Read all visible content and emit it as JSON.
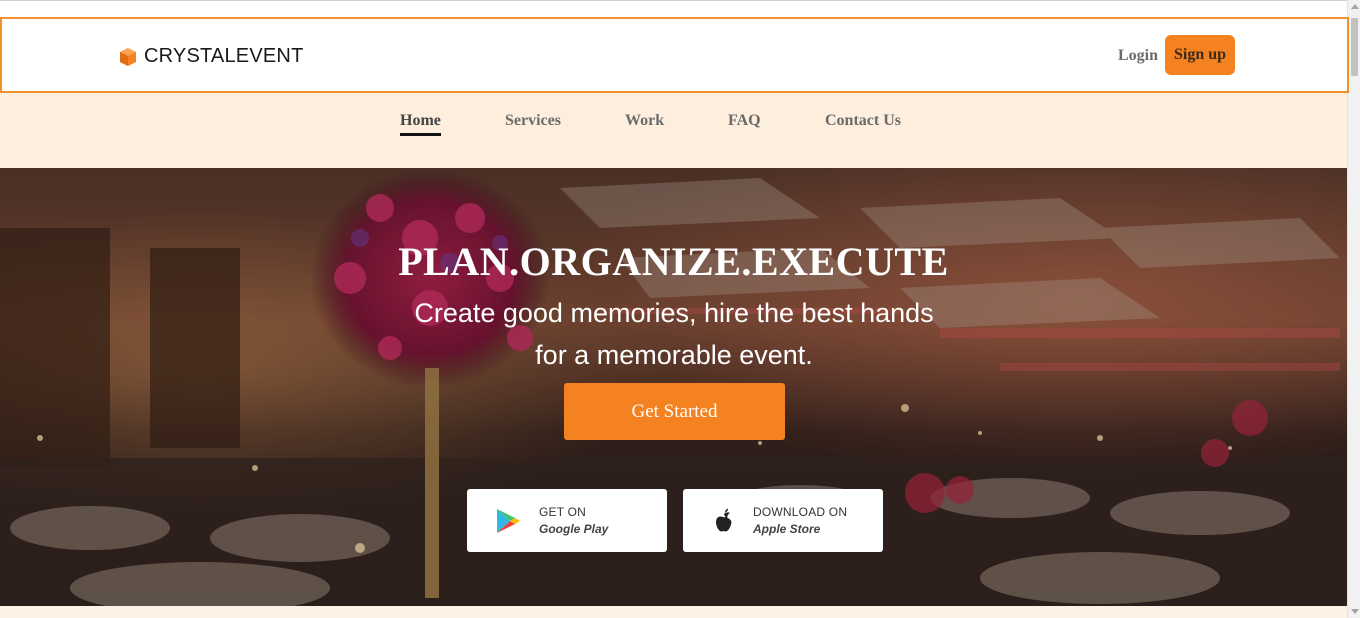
{
  "brand": {
    "name": "CRYSTALEVENT",
    "icon": "cube-icon",
    "icon_color": "#f58220"
  },
  "header": {
    "login_label": "Login",
    "signup_label": "Sign up"
  },
  "nav": {
    "items": [
      {
        "label": "Home",
        "active": true
      },
      {
        "label": "Services",
        "active": false
      },
      {
        "label": "Work",
        "active": false
      },
      {
        "label": "FAQ",
        "active": false
      },
      {
        "label": "Contact Us",
        "active": false
      }
    ]
  },
  "hero": {
    "title": "PLAN.ORGANIZE.EXECUTE",
    "subtitle_line1": "Create good memories, hire the best hands",
    "subtitle_line2": "for a memorable event.",
    "cta_label": "Get Started",
    "background": "banquet-hall-photo"
  },
  "stores": [
    {
      "line1": "GET ON",
      "line2": "Google Play",
      "icon": "google-play-icon"
    },
    {
      "line1": "DOWNLOAD ON",
      "line2": "Apple Store",
      "icon": "apple-icon"
    }
  ],
  "colors": {
    "accent": "#f58220",
    "header_border": "#f0912b",
    "nav_bg": "#fdeedd"
  }
}
